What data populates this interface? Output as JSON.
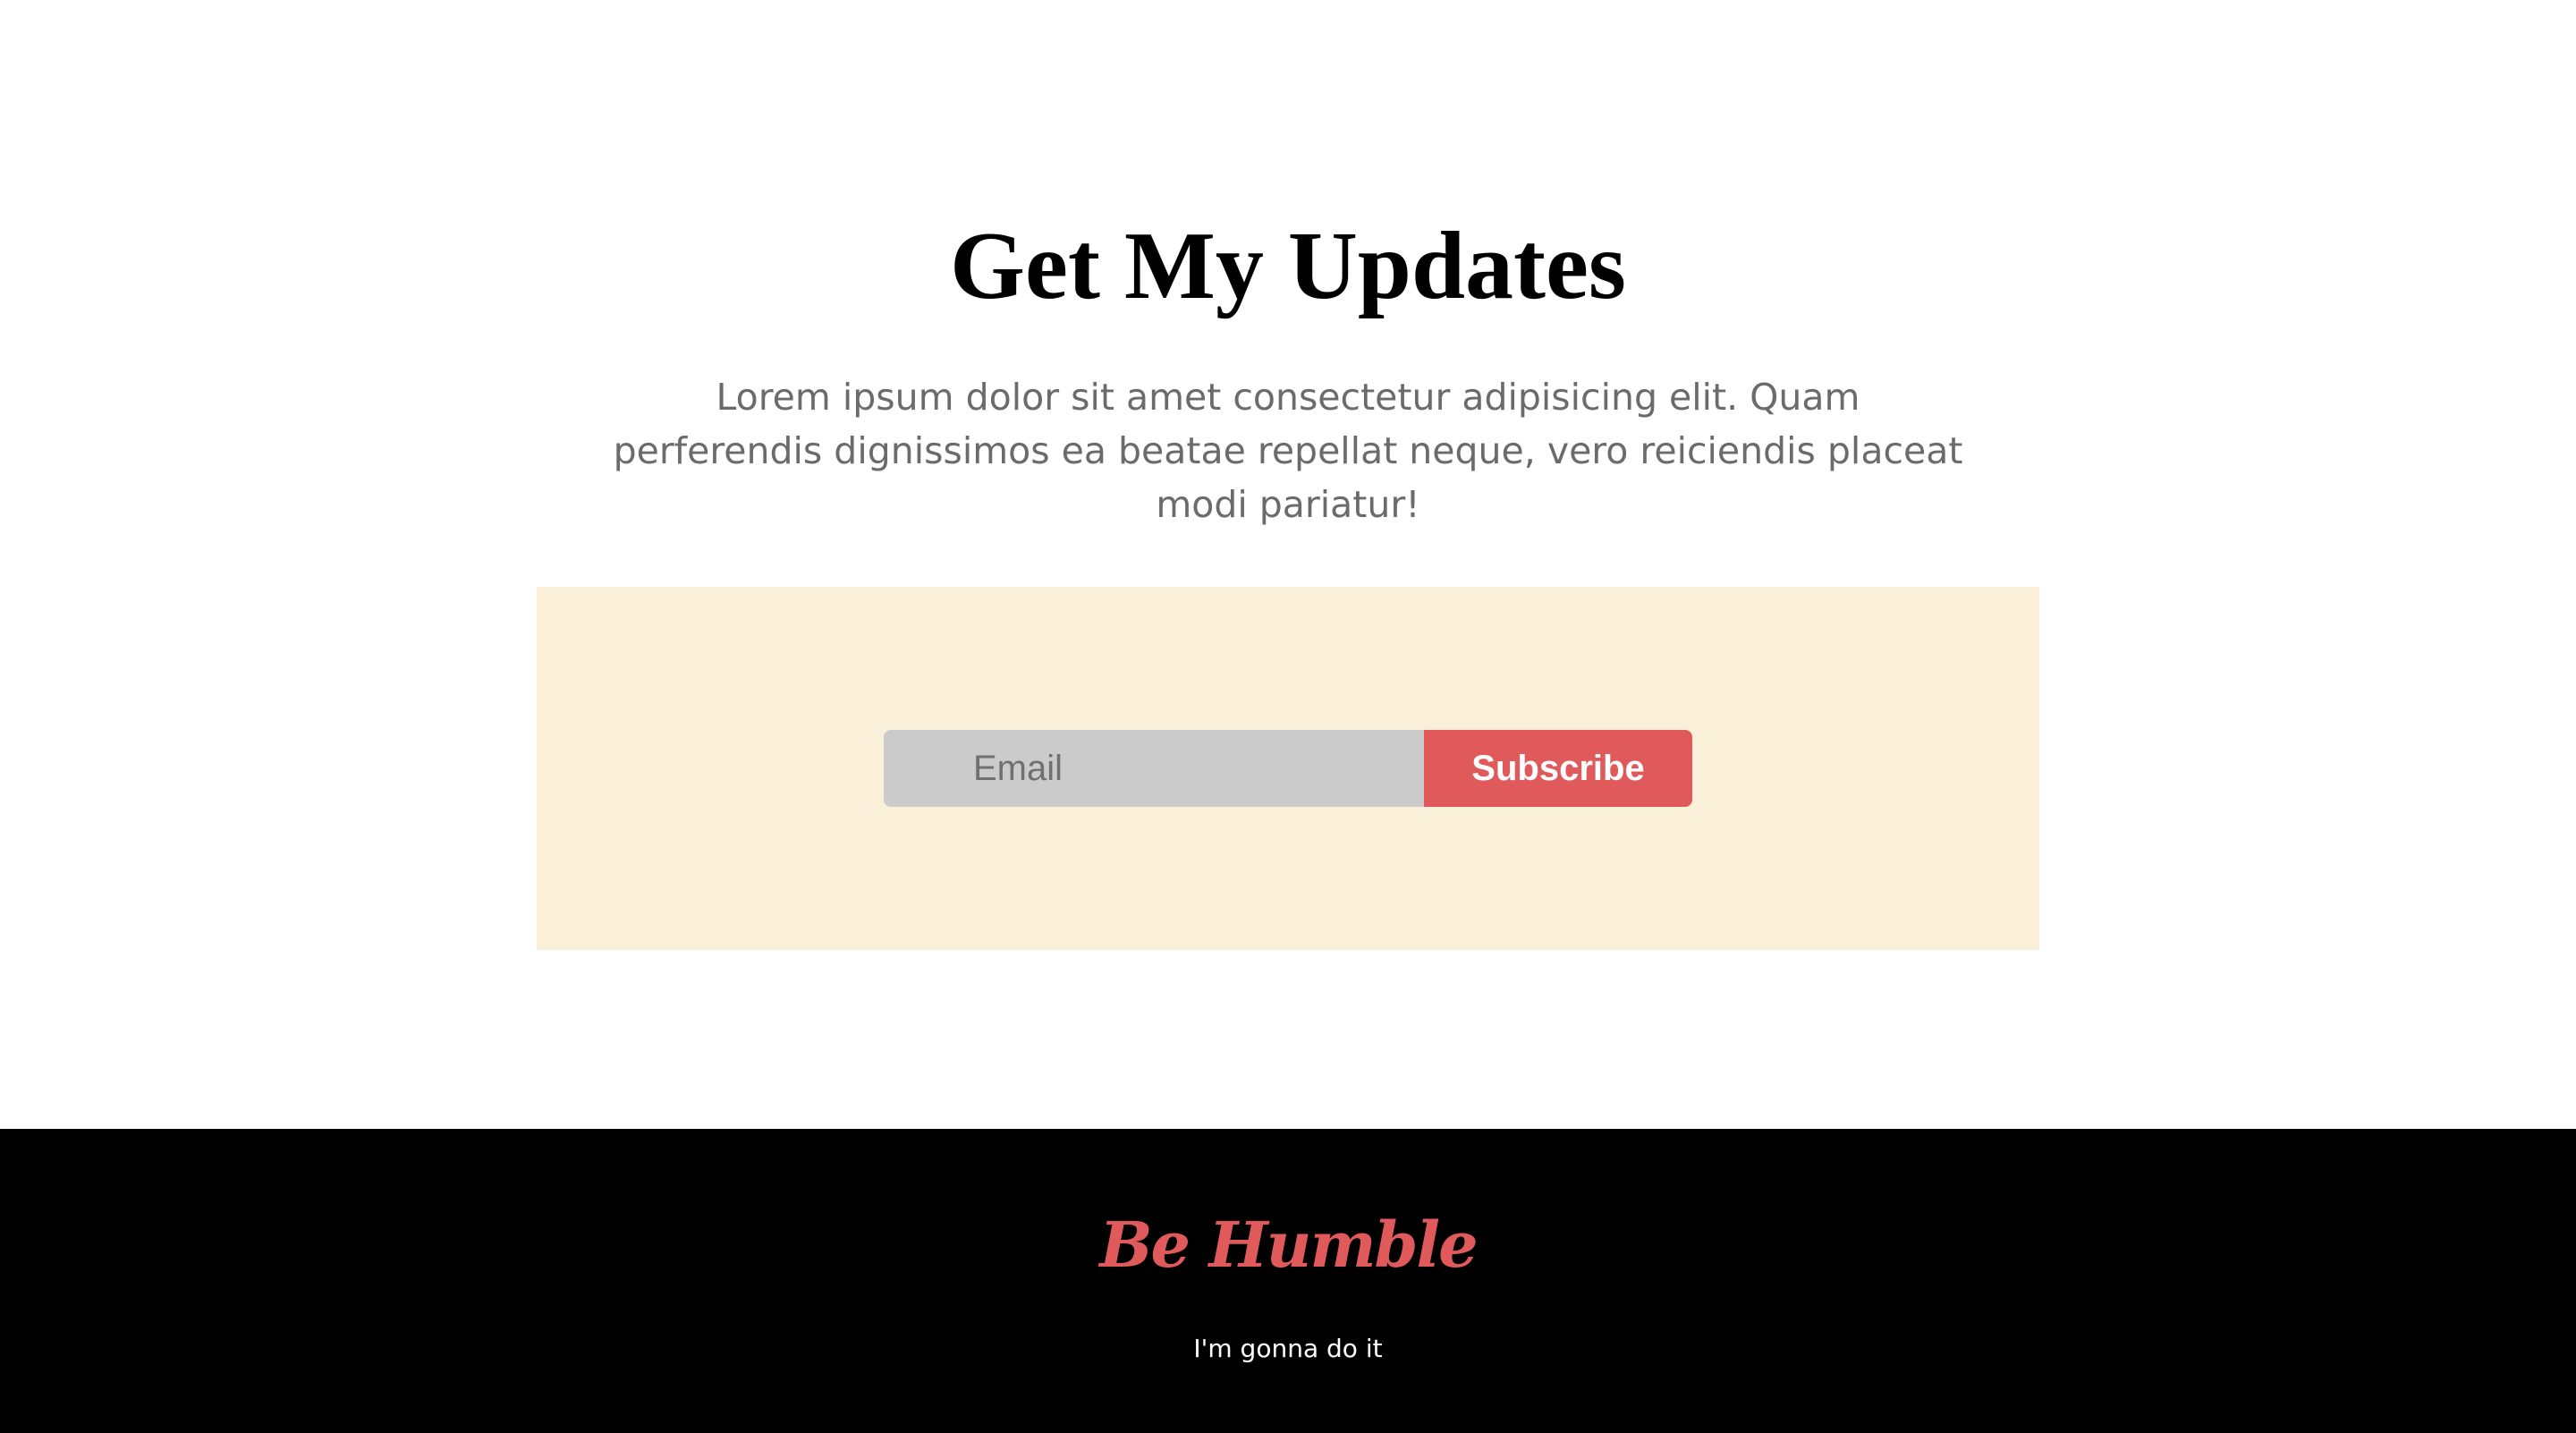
{
  "updates": {
    "title": "Get My Updates",
    "description": "Lorem ipsum dolor sit amet consectetur adipisicing elit. Quam perferendis dignissimos ea beatae repellat neque, vero reiciendis placeat modi pariatur!",
    "form": {
      "email_placeholder": "Email",
      "subscribe_label": "Subscribe"
    },
    "colors": {
      "panel_background": "#faefd9",
      "accent": "#e05a5c",
      "input_background": "#cbcbcb"
    }
  },
  "footer": {
    "brand": "Be Humble",
    "tagline": "I'm gonna do it",
    "colors": {
      "background": "#000000",
      "brand": "#e05a5c"
    }
  }
}
